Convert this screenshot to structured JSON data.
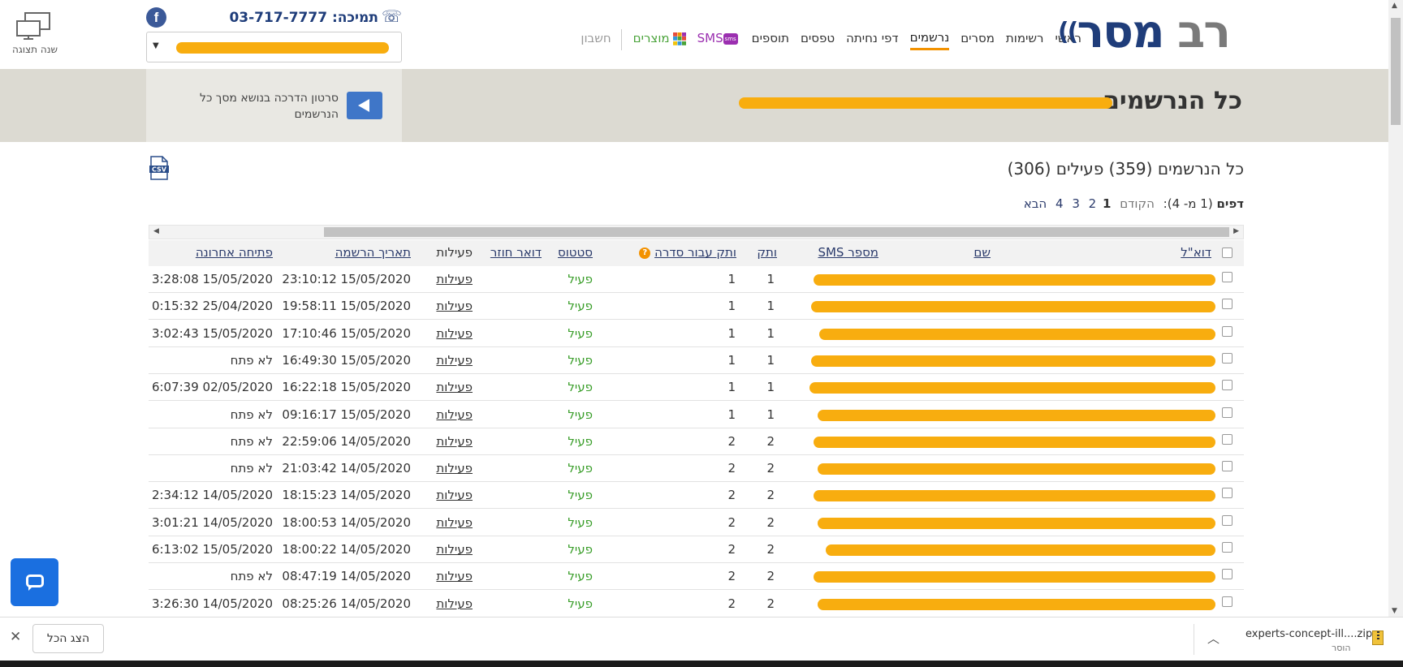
{
  "header": {
    "display_switch_label": "שנה תצוגה",
    "support_label": "תמיכה: 03-717-7777",
    "facebook_letter": "f",
    "account_select_value": "",
    "logo": {
      "part1": "רב",
      "part2": "מסר"
    },
    "nav": [
      {
        "label": "ראשי",
        "active": false
      },
      {
        "label": "רשימות",
        "active": false
      },
      {
        "label": "מסרים",
        "active": false
      },
      {
        "label": "נרשמים",
        "active": true
      },
      {
        "label": "דפי נחיתה",
        "active": false
      },
      {
        "label": "טפסים",
        "active": false
      },
      {
        "label": "תוספים",
        "active": false
      }
    ],
    "sms_label": "SMS",
    "sms_badge": "sms",
    "products_label": "מוצרים",
    "account_label": "חשבון"
  },
  "banner": {
    "title": "כל הנרשמים",
    "tutorial_text": "סרטון הדרכה בנושא מסך כל הנרשמים"
  },
  "main": {
    "count_title": "כל הנרשמים (359) פעילים (306)",
    "pager": {
      "label": "דפים",
      "info": "(1 מ- 4):",
      "prev": "הקודם",
      "current": "1",
      "pages": [
        "2",
        "3",
        "4"
      ],
      "next": "הבא"
    },
    "csv_label": "CSV"
  },
  "table": {
    "columns": {
      "email": "דוא\"ל",
      "name": "שם",
      "sms": "מספר SMS",
      "tenure": "ותק",
      "series_tenure": "ותק עבור סדרה",
      "status": "סטטוס",
      "return_mail": "דואר חוזר",
      "actions": "פעילות",
      "reg_date": "תאריך הרשמה",
      "last_open": "פתיחה אחרונה"
    },
    "rows": [
      {
        "tenure": "1",
        "series_tenure": "1",
        "status": "פעיל",
        "actions": "פעילות",
        "reg_date": "23:10:12 15/05/2020",
        "last_open": "3:28:08 15/05/2020"
      },
      {
        "tenure": "1",
        "series_tenure": "1",
        "status": "פעיל",
        "actions": "פעילות",
        "reg_date": "19:58:11 15/05/2020",
        "last_open": "0:15:32 25/04/2020"
      },
      {
        "tenure": "1",
        "series_tenure": "1",
        "status": "פעיל",
        "actions": "פעילות",
        "reg_date": "17:10:46 15/05/2020",
        "last_open": "3:02:43 15/05/2020"
      },
      {
        "tenure": "1",
        "series_tenure": "1",
        "status": "פעיל",
        "actions": "פעילות",
        "reg_date": "16:49:30 15/05/2020",
        "last_open": "לא פתח"
      },
      {
        "tenure": "1",
        "series_tenure": "1",
        "status": "פעיל",
        "actions": "פעילות",
        "reg_date": "16:22:18 15/05/2020",
        "last_open": "6:07:39 02/05/2020"
      },
      {
        "tenure": "1",
        "series_tenure": "1",
        "status": "פעיל",
        "actions": "פעילות",
        "reg_date": "09:16:17 15/05/2020",
        "last_open": "לא פתח"
      },
      {
        "tenure": "2",
        "series_tenure": "2",
        "status": "פעיל",
        "actions": "פעילות",
        "reg_date": "22:59:06 14/05/2020",
        "last_open": "לא פתח"
      },
      {
        "tenure": "2",
        "series_tenure": "2",
        "status": "פעיל",
        "actions": "פעילות",
        "reg_date": "21:03:42 14/05/2020",
        "last_open": "לא פתח"
      },
      {
        "tenure": "2",
        "series_tenure": "2",
        "status": "פעיל",
        "actions": "פעילות",
        "reg_date": "18:15:23 14/05/2020",
        "last_open": "2:34:12 14/05/2020"
      },
      {
        "tenure": "2",
        "series_tenure": "2",
        "status": "פעיל",
        "actions": "פעילות",
        "reg_date": "18:00:53 14/05/2020",
        "last_open": "3:01:21 14/05/2020"
      },
      {
        "tenure": "2",
        "series_tenure": "2",
        "status": "פעיל",
        "actions": "פעילות",
        "reg_date": "18:00:22 14/05/2020",
        "last_open": "6:13:02 15/05/2020"
      },
      {
        "tenure": "2",
        "series_tenure": "2",
        "status": "פעיל",
        "actions": "פעילות",
        "reg_date": "08:47:19 14/05/2020",
        "last_open": "לא פתח"
      },
      {
        "tenure": "2",
        "series_tenure": "2",
        "status": "פעיל",
        "actions": "פעילות",
        "reg_date": "08:25:26 14/05/2020",
        "last_open": "3:26:30 14/05/2020"
      }
    ]
  },
  "download_bar": {
    "show_all": "הצג הכל",
    "file_name": "experts-concept-ill....zip",
    "file_status": "הוסר"
  },
  "colors": {
    "brand_navy": "#1f3d7a",
    "active_tab": "#f39200",
    "status_active": "#3a9e2a",
    "redaction": "#f8ad0f",
    "chat_button": "#1a6fe0"
  }
}
